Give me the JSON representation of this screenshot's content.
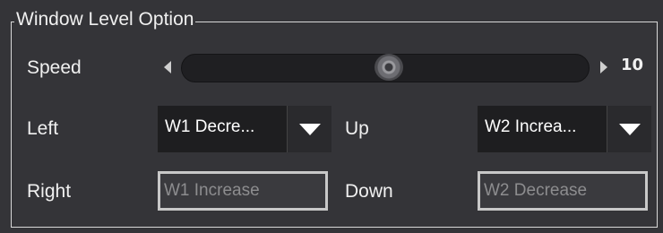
{
  "group": {
    "title": "Window Level Option"
  },
  "speed": {
    "label": "Speed",
    "value": "10",
    "position_fraction": 0.5
  },
  "left": {
    "label": "Left",
    "selected": "W1 Decre..."
  },
  "up": {
    "label": "Up",
    "selected": "W2 Increa..."
  },
  "right": {
    "label": "Right",
    "placeholder": "W1 Increase"
  },
  "down": {
    "label": "Down",
    "placeholder": "W2 Decrease"
  }
}
